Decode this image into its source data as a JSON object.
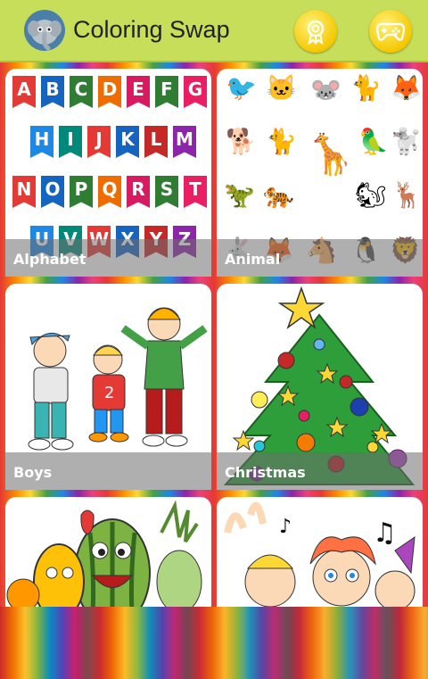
{
  "header": {
    "title": "Coloring Swap"
  },
  "categories": [
    {
      "label": "Alphabet"
    },
    {
      "label": "Animal"
    },
    {
      "label": "Boys"
    },
    {
      "label": "Christmas"
    },
    {
      "label": ""
    },
    {
      "label": ""
    }
  ],
  "alphabet_rows": [
    [
      "A",
      "B",
      "C",
      "D",
      "E",
      "F",
      "G"
    ],
    [
      "H",
      "I",
      "J",
      "K",
      "L",
      "M"
    ],
    [
      "N",
      "O",
      "P",
      "Q",
      "R",
      "S",
      "T"
    ],
    [
      "U",
      "V",
      "W",
      "X",
      "Y",
      "Z"
    ]
  ],
  "colors": {
    "topbar": "#c6de5a",
    "button": "#f5c800"
  },
  "icons": {
    "app": "elephant-icon",
    "awards": "award-ribbon-icon",
    "games": "gamepad-icon"
  }
}
